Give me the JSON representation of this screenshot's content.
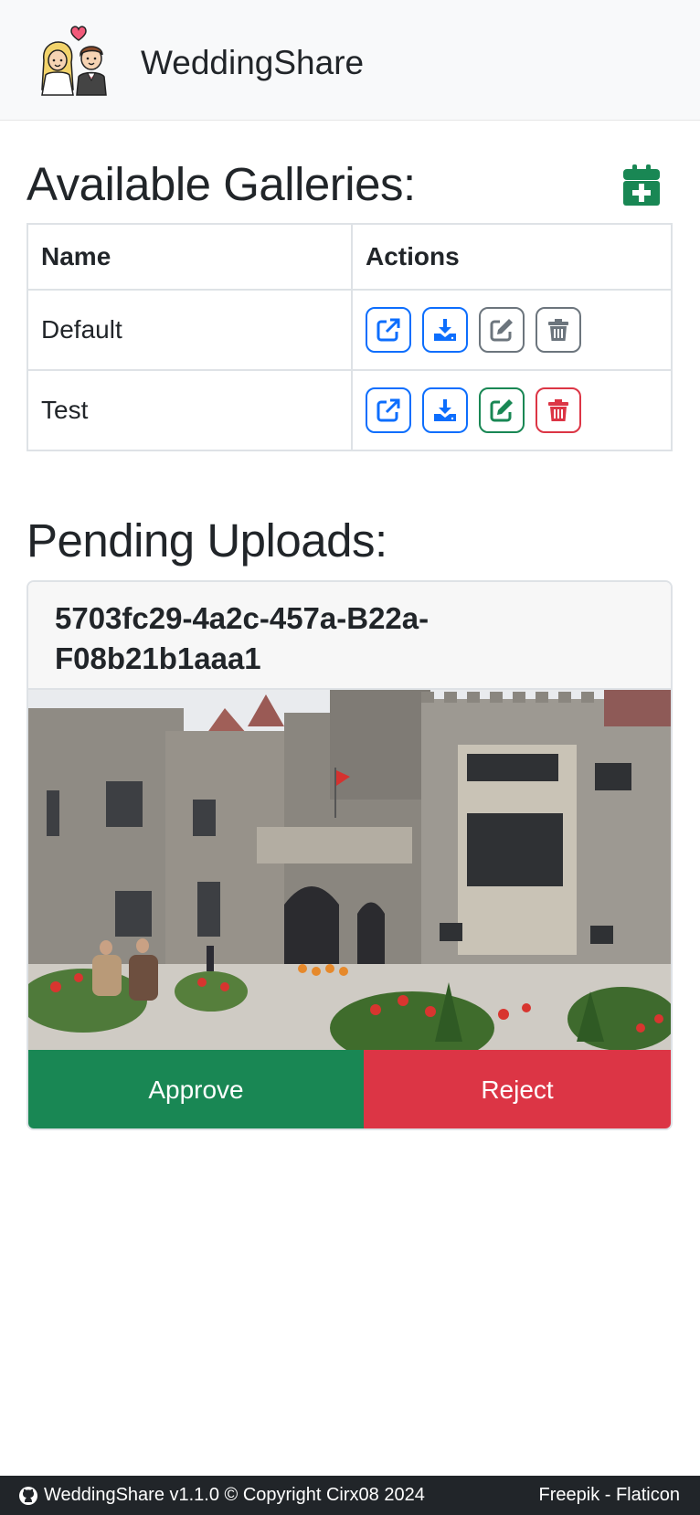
{
  "header": {
    "brand_name": "WeddingShare",
    "logo_icon": "bride-groom-logo-icon"
  },
  "galleries": {
    "title": "Available Galleries:",
    "add_icon": "calendar-plus-icon",
    "columns": [
      "Name",
      "Actions"
    ],
    "rows": [
      {
        "name": "Default",
        "actions": [
          "open-link",
          "download",
          "edit",
          "delete"
        ],
        "state": "default"
      },
      {
        "name": "Test",
        "actions": [
          "open-link",
          "download",
          "edit",
          "delete"
        ],
        "state": "editable"
      }
    ]
  },
  "pending": {
    "title": "Pending Uploads:",
    "item_id": "5703fc29-4a2c-457a-B22a-F08b21b1aaa1",
    "image_alt": "castle-courtyard-photo",
    "approve_label": "Approve",
    "reject_label": "Reject"
  },
  "footer": {
    "left_text": "WeddingShare v1.1.0 © Copyright Cirx08 2024",
    "right_text": "Freepik - Flaticon",
    "github_icon": "github-icon"
  },
  "colors": {
    "primary": "#0d6efd",
    "success": "#198754",
    "danger": "#dc3545",
    "secondary": "#6c757d",
    "dark": "#212529"
  }
}
